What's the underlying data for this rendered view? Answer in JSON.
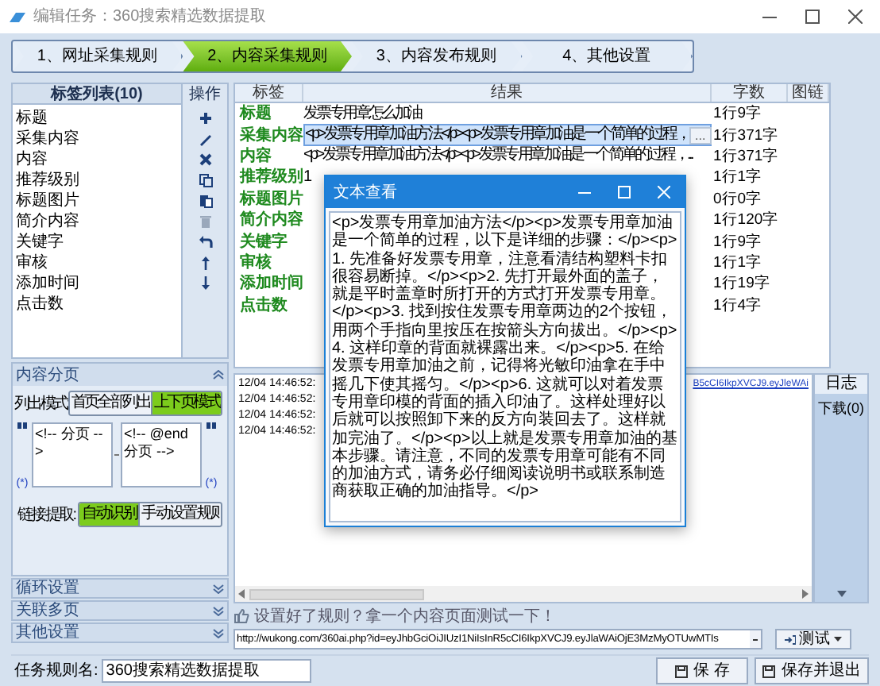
{
  "window": {
    "title": "编辑任务：360搜索精选数据提取"
  },
  "steps": [
    {
      "label": "1、网址采集规则",
      "selected": false
    },
    {
      "label": "2、内容采集规则",
      "selected": true
    },
    {
      "label": "3、内容发布规则",
      "selected": false
    },
    {
      "label": "4、其他设置",
      "selected": false
    }
  ],
  "tag_list": {
    "title": "标签列表(10)",
    "items": [
      "标题",
      "采集内容",
      "内容",
      "推荐级别",
      "标题图片",
      "简介内容",
      "关键字",
      "审核",
      "添加时间",
      "点击数"
    ]
  },
  "operations": {
    "title": "操作"
  },
  "pagination": {
    "title": "内容分页",
    "list_mode_label": "列出模式:",
    "list_modes": [
      {
        "label": "首页全部列出",
        "selected": false
      },
      {
        "label": "上下页模式",
        "selected": true
      }
    ],
    "start_marker": "<!-- 分页 -->",
    "end_marker": "<!-- @end 分页 -->",
    "wildcard_left": "(*)",
    "wildcard_right": "(*)",
    "link_label": "链接提取:",
    "link_modes": [
      {
        "label": "自动识别",
        "selected": true
      },
      {
        "label": "手动设置规则",
        "selected": false
      }
    ]
  },
  "sections": [
    "循环设置",
    "关联多页",
    "其他设置"
  ],
  "table": {
    "columns": [
      "标签",
      "结果",
      "字数",
      "图链"
    ],
    "rows": [
      {
        "tag": "标题",
        "result": "发票专用章怎么加油",
        "count": "1行9字",
        "selected": false
      },
      {
        "tag": "采集内容",
        "result": "<p>发票专用章加油方法</p><p>发票专用章加油是一个简单的过程，",
        "button": "...",
        "count": "1行371字",
        "selected": true
      },
      {
        "tag": "内容",
        "result": "<p>发票专用章加油方法</p><p>发票专用章加油是一个简单的过程，...",
        "count": "1行371字",
        "selected": false
      },
      {
        "tag": "推荐级别",
        "result": "1",
        "count": "1行1字",
        "selected": false
      },
      {
        "tag": "标题图片",
        "count": "0行0字",
        "selected": false
      },
      {
        "tag": "简介内容",
        "count": "1行120字",
        "selected": false
      },
      {
        "tag": "关键字",
        "count": "1行9字",
        "selected": false
      },
      {
        "tag": "审核",
        "count": "1行1字",
        "selected": false
      },
      {
        "tag": "添加时间",
        "count": "1行19字",
        "selected": false
      },
      {
        "tag": "点击数",
        "count": "1行4字",
        "selected": false
      }
    ]
  },
  "log": {
    "lines": [
      {
        "time": "12/04 14:46:52:",
        "link": "B5cCI6IkpXVCJ9.eyJleWAi"
      },
      {
        "time": "12/04 14:46:52:"
      },
      {
        "time": "12/04 14:46:52:"
      },
      {
        "time": "12/04 14:46:52:"
      }
    ]
  },
  "log_panel": {
    "title": "日志",
    "items": [
      "下载(0)"
    ]
  },
  "hint": "设置好了规则？拿一个内容页面测试一下！",
  "test_url": "http://wukong.com/360ai.php?id=eyJhbGciOiJIUzI1NiIsInR5cCI6IkpXVCJ9.eyJlaWAiOjE3MzMyOTUwMTIs",
  "test_button": "测试",
  "task_name": {
    "label": "任务规则名:",
    "value": "360搜索精选数据提取"
  },
  "buttons": [
    "保 存",
    "保存并退出"
  ],
  "dialog": {
    "title": "文本查看",
    "text": "<p>发票专用章加油方法</p><p>发票专用章加油是一个简单的过程，以下是详细的步骤：</p><p>1. 先准备好发票专用章，注意看清结构塑料卡扣很容易断掉。</p><p>2. 先打开最外面的盖子，就是平时盖章时所打开的方式打开发票专用章。</p><p>3. 找到按住发票专用章两边的2个按钮，用两个手指向里按压在按箭头方向拔出。</p><p>4. 这样印章的背面就裸露出来。</p><p>5. 在给发票专用章加油之前，记得将光敏印油拿在手中摇几下使其摇匀。</p><p>6. 这就可以对着发票专用章印模的背面的插入印油了。这样处理好以后就可以按照卸下来的反方向装回去了。这样就加完油了。</p><p>以上就是发票专用章加油的基本步骤。请注意，不同的发票专用章可能有不同的加油方式，请务必仔细阅读说明书或联系制造商获取正确的加油指导。</p>"
  }
}
